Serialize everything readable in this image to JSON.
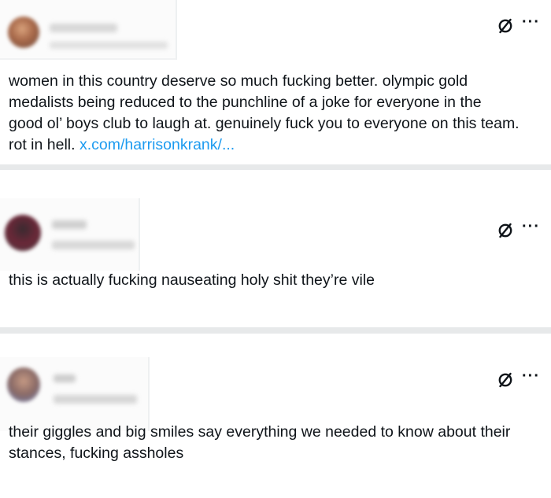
{
  "posts": [
    {
      "text": "women in this country deserve so much fucking better. olympic gold medalists being reduced to the punchline of a joke for everyone in the good ol’ boys club to laugh at. genuinely fuck you to everyone on this team. rot in hell.",
      "link": "x.com/harrisonkrank/...",
      "icons": [
        "slash-circle-icon",
        "more-options-icon"
      ]
    },
    {
      "text": "this is actually fucking nauseating holy shit they’re vile",
      "icons": [
        "slash-circle-icon",
        "more-options-icon"
      ]
    },
    {
      "text": "their giggles and big smiles say everything we needed to know about their stances, fucking assholes",
      "icons": [
        "slash-circle-icon",
        "more-options-icon"
      ]
    }
  ],
  "more_glyph": "···",
  "colors": {
    "link": "#1d9bf0",
    "text": "#0f1419",
    "separator": "#e7e9ea"
  }
}
